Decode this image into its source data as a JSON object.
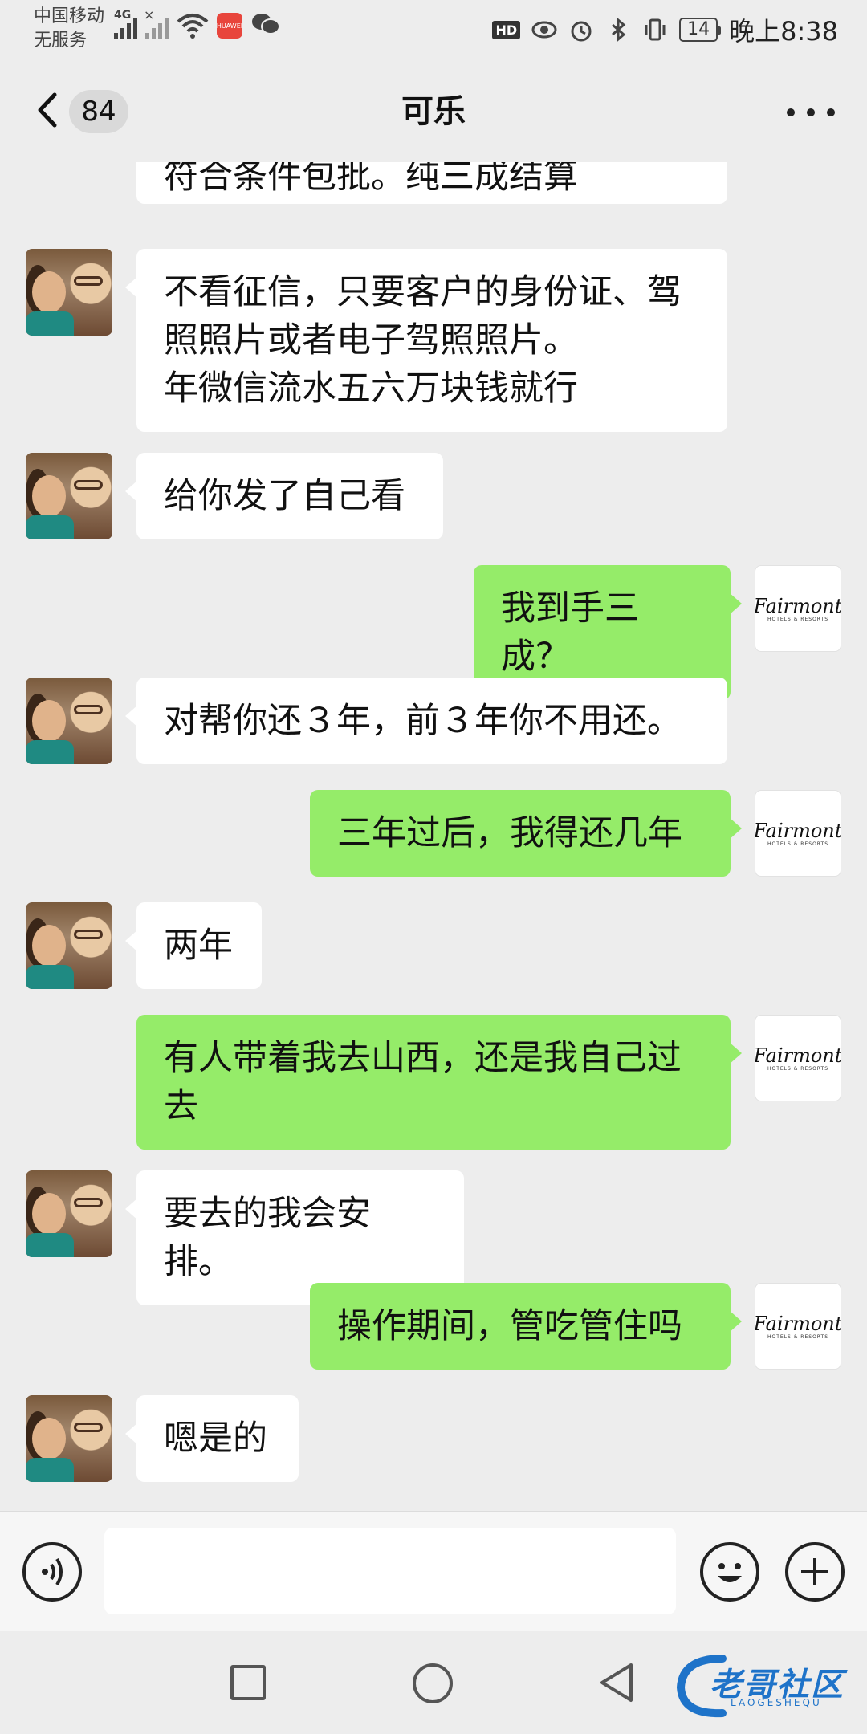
{
  "status_bar": {
    "carrier_line1": "中国移动",
    "carrier_line2": "无服务",
    "network_tag": "4G",
    "app_badge": "HUAWEI",
    "hd_label": "HD",
    "battery": "14",
    "time": "晚上8:38"
  },
  "header": {
    "unread_count": "84",
    "title": "可乐"
  },
  "contact_avatar_icon": "contact-avatar-painting",
  "my_avatar": {
    "logo": "Fairmont",
    "sub": "HOTELS & RESORTS"
  },
  "messages": [
    {
      "side": "in",
      "text": "符合条件包批。纯三成结算",
      "cut": true
    },
    {
      "side": "in",
      "text": "不看征信，只要客户的身份证、驾照照片或者电子驾照照片。\n年微信流水五六万块钱就行"
    },
    {
      "side": "in",
      "text": "给你发了自己看"
    },
    {
      "side": "out",
      "text": "我到手三成？"
    },
    {
      "side": "in",
      "text": "对帮你还３年，前３年你不用还。"
    },
    {
      "side": "out",
      "text": "三年过后，我得还几年"
    },
    {
      "side": "in",
      "text": "两年"
    },
    {
      "side": "out",
      "text": "有人带着我去山西，还是我自己过去"
    },
    {
      "side": "in",
      "text": "要去的我会安排。"
    },
    {
      "side": "out",
      "text": "操作期间，管吃管住吗"
    },
    {
      "side": "in",
      "text": "嗯是的"
    }
  ],
  "input_bar": {
    "placeholder": "",
    "value": ""
  },
  "watermark": {
    "text": "老哥社区",
    "sub": "LAOGESHEQU"
  },
  "colors": {
    "background": "#ededed",
    "bubble_out": "#95ec69",
    "bubble_in": "#ffffff",
    "watermark": "#1e73c9"
  }
}
